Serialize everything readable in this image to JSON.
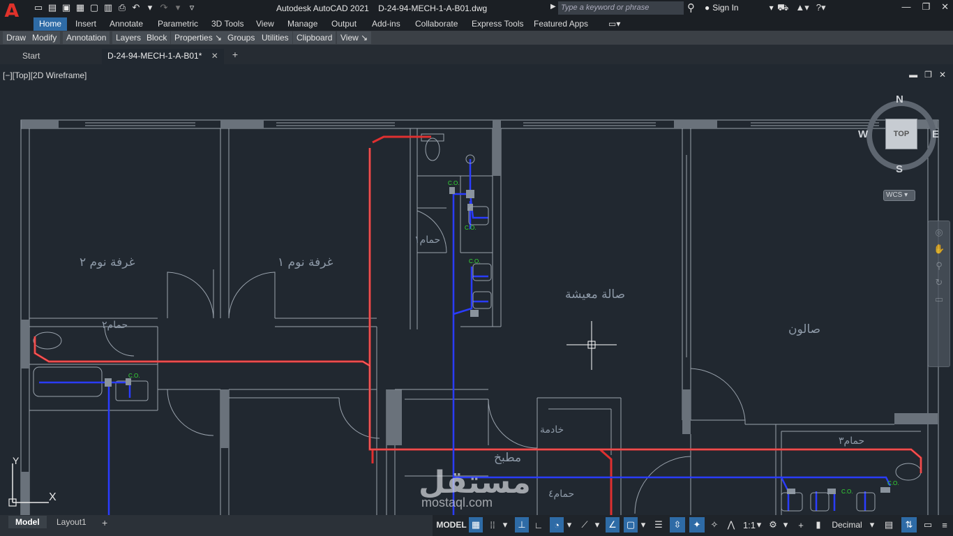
{
  "titlebar": {
    "app_logo": "A",
    "app_title": "Autodesk AutoCAD 2021",
    "file_name": "D-24-94-MECH-1-A-B01.dwg",
    "search_placeholder": "Type a keyword or phrase",
    "sign_in": "Sign In"
  },
  "ribbon": {
    "tabs": [
      "Home",
      "Insert",
      "Annotate",
      "Parametric",
      "3D Tools",
      "View",
      "Manage",
      "Output",
      "Add-ins",
      "Collaborate",
      "Express Tools",
      "Featured Apps"
    ],
    "active_tab": "Home",
    "panels": [
      "Draw",
      "Modify",
      "Annotation",
      "Layers",
      "Block",
      "Properties ↘",
      "Groups",
      "Utilities",
      "Clipboard",
      "View ↘"
    ]
  },
  "doc_tabs": {
    "start": "Start",
    "active": "D-24-94-MECH-1-A-B01*",
    "close": "✕",
    "add": "+"
  },
  "viewport": {
    "label": "[−][Top][2D Wireframe]",
    "rooms": {
      "bedroom2": "غرفة نوم ٢",
      "bedroom1": "غرفة نوم ١",
      "bath1": "حمام١",
      "bath2": "حمام٢",
      "bath3": "حمام٣",
      "bath4": "حمام٤",
      "living": "صالة معيشة",
      "salon": "صالون",
      "maid": "خادمة",
      "kitchen": "مطبخ"
    },
    "cleanout_label": "C.O.",
    "viewcube": {
      "top": "TOP",
      "north": "N",
      "south": "S",
      "east": "E",
      "west": "W",
      "wcs": "WCS"
    },
    "ucs": {
      "x": "X",
      "y": "Y"
    }
  },
  "layout_tabs": [
    "Model",
    "Layout1"
  ],
  "layout_add": "+",
  "status": {
    "model": "MODEL",
    "scale": "1:1",
    "units": "Decimal"
  },
  "watermark": {
    "main": "مستقل",
    "sub": "mostaql.com"
  },
  "colors": {
    "background": "#212830",
    "ribbon_active": "#2e6ba6",
    "wall_lines": "#a8b0ba",
    "drain_pipe": "#e03030",
    "supply_pipe": "#2a3cff",
    "cleanout_text": "#35e035"
  }
}
